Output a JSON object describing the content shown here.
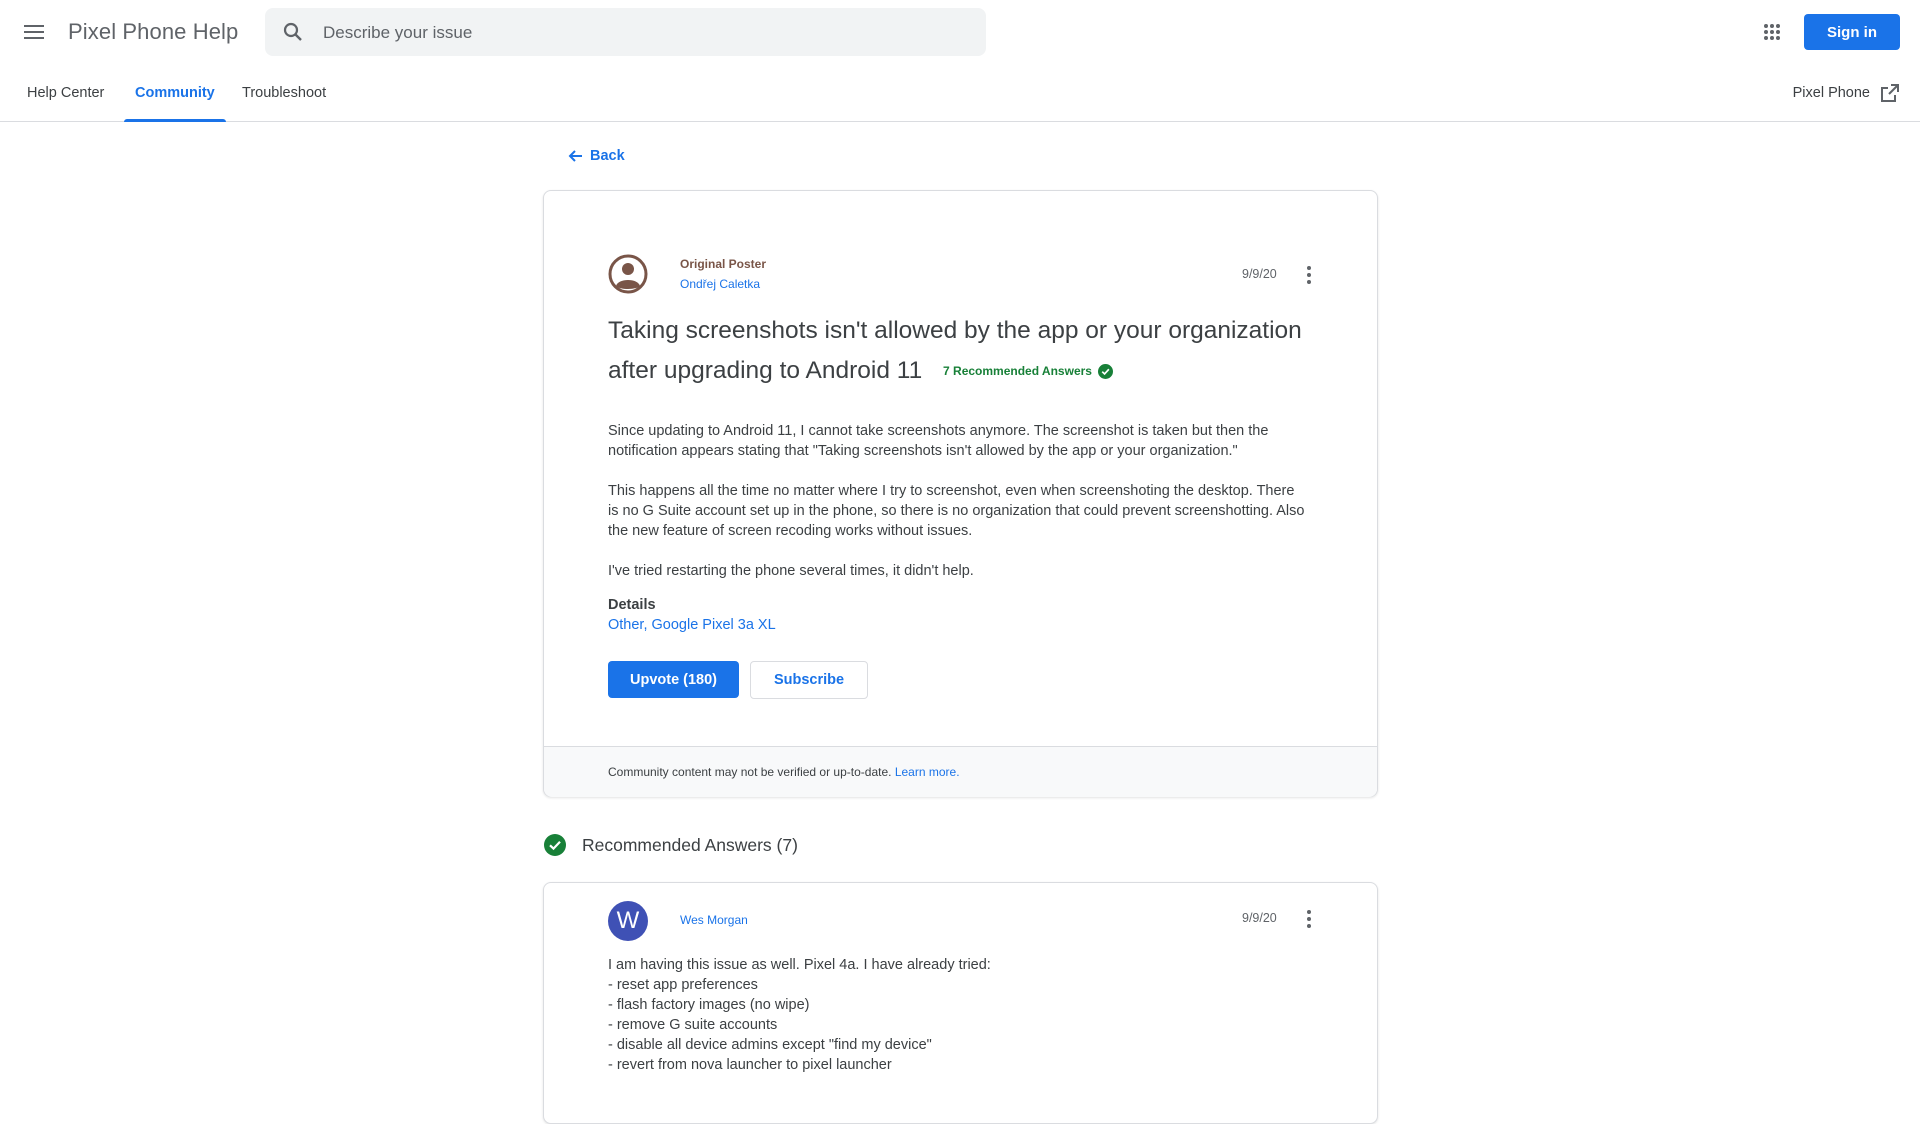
{
  "header": {
    "app_title": "Pixel Phone Help",
    "search_placeholder": "Describe your issue",
    "signin_label": "Sign in"
  },
  "nav": {
    "tabs": [
      {
        "label": "Help Center",
        "active": false
      },
      {
        "label": "Community",
        "active": true
      },
      {
        "label": "Troubleshoot",
        "active": false
      }
    ],
    "external_link_label": "Pixel Phone"
  },
  "back_label": "Back",
  "question": {
    "poster_role": "Original Poster",
    "poster_name": "Ondřej Caletka",
    "date": "9/9/20",
    "title": "Taking screenshots isn't allowed by the app or your organization after upgrading to Android 11",
    "recommended_count_label": "7 Recommended Answers",
    "body": [
      "Since updating to Android 11, I cannot take screenshots anymore. The screenshot is taken but then the notification appears stating that \"Taking screenshots isn't allowed by the app or your organization.\"",
      "This happens all the time no matter where I try to screenshot, even when screenshoting the desktop. There is no G Suite account set up in the phone, so there is no organization that could prevent screenshotting. Also the new feature of screen recoding works without issues.",
      "I've tried restarting the phone several times, it didn't help."
    ],
    "details_label": "Details",
    "details_value": "Other, Google Pixel 3a XL",
    "upvote_label": "Upvote (180)",
    "subscribe_label": "Subscribe",
    "footer_text": "Community content may not be verified or up-to-date.",
    "footer_link": "Learn more."
  },
  "recommended": {
    "title": "Recommended Answers (7)"
  },
  "answer": {
    "avatar_letter": "W",
    "author": "Wes Morgan",
    "date": "9/9/20",
    "lines": [
      "I am having this issue as well. Pixel 4a. I have already tried:",
      "- reset app preferences",
      "- flash factory images (no wipe)",
      "- remove G suite accounts",
      "- disable all device admins except \"find my device\"",
      "- revert from nova launcher to pixel launcher"
    ]
  },
  "colors": {
    "accent": "#1a73e8",
    "success": "#188038",
    "poster_role": "#795548",
    "answer_avatar": "#3f51b5"
  }
}
